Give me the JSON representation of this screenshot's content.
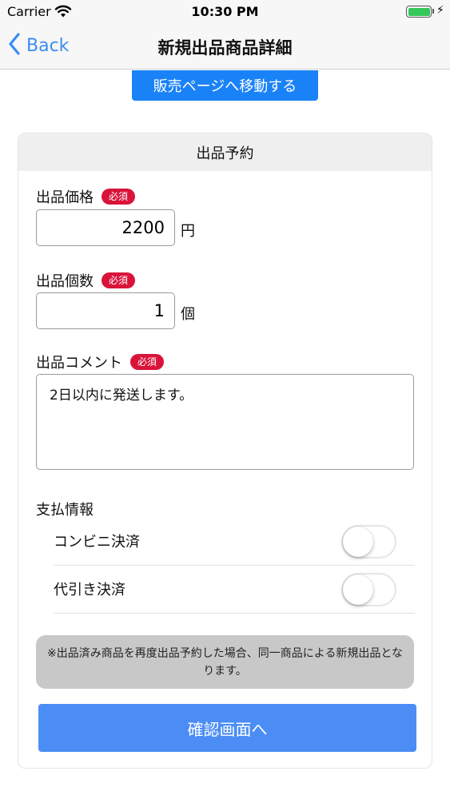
{
  "status_bar": {
    "carrier": "Carrier",
    "time": "10:30 PM",
    "charging_symbol": "⚡"
  },
  "nav": {
    "back_label": "Back",
    "title": "新規出品商品詳細"
  },
  "goto_sale_label": "販売ページへ移動する",
  "card": {
    "header": "出品予約",
    "price": {
      "label": "出品価格",
      "badge": "必須",
      "value": "2200",
      "unit": "円"
    },
    "quantity": {
      "label": "出品個数",
      "badge": "必須",
      "value": "1",
      "unit": "個"
    },
    "comment": {
      "label": "出品コメント",
      "badge": "必須",
      "value": "2日以内に発送します。"
    },
    "payment": {
      "title": "支払情報",
      "options": [
        {
          "label": "コンビニ決済",
          "on": false
        },
        {
          "label": "代引き決済",
          "on": false
        }
      ]
    },
    "notice": "※出品済み商品を再度出品予約した場合、同一商品による新規出品となります。",
    "confirm_label": "確認画面へ"
  },
  "colors": {
    "accent_blue": "#1a82f7",
    "confirm_blue": "#4b8df5",
    "required_red": "#d9143a",
    "battery_green": "#35c759"
  },
  "icons": [
    "wifi-icon",
    "battery-icon",
    "charging-bolt-icon",
    "chevron-left-icon"
  ]
}
